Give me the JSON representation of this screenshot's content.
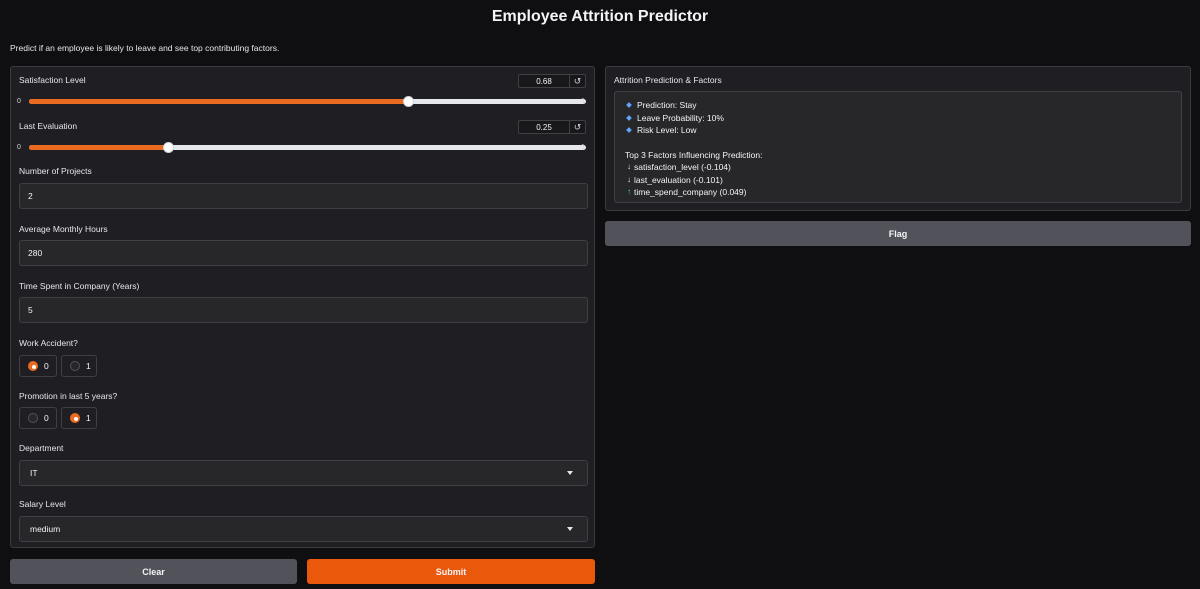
{
  "header": {
    "title": "Employee Attrition Predictor",
    "subtitle": "Predict if an employee is likely to leave and see top contributing factors."
  },
  "form": {
    "satisfaction": {
      "label": "Satisfaction Level",
      "value": "0.68",
      "min": "0",
      "max": "1",
      "fraction": 0.68
    },
    "evaluation": {
      "label": "Last Evaluation",
      "value": "0.25",
      "min": "0",
      "max": "1",
      "fraction": 0.25
    },
    "projects": {
      "label": "Number of Projects",
      "value": "2"
    },
    "hours": {
      "label": "Average Monthly Hours",
      "value": "280"
    },
    "tenure": {
      "label": "Time Spent in Company (Years)",
      "value": "5"
    },
    "accident": {
      "label": "Work Accident?",
      "options": [
        "0",
        "1"
      ],
      "selected": "0"
    },
    "promotion": {
      "label": "Promotion in last 5 years?",
      "options": [
        "0",
        "1"
      ],
      "selected": "1"
    },
    "department": {
      "label": "Department",
      "value": "IT"
    },
    "salary": {
      "label": "Salary Level",
      "value": "medium"
    }
  },
  "buttons": {
    "clear": "Clear",
    "submit": "Submit",
    "flag": "Flag"
  },
  "output": {
    "label": "Attrition Prediction & Factors",
    "bullets": [
      "Prediction: Stay",
      "Leave Probability: 10%",
      "Risk Level: Low"
    ],
    "factors_heading": "Top 3 Factors Influencing Prediction:",
    "factors": [
      {
        "direction": "down",
        "text": "satisfaction_level (-0.104)"
      },
      {
        "direction": "down",
        "text": "last_evaluation (-0.101)"
      },
      {
        "direction": "up",
        "text": "time_spend_company (0.049)"
      }
    ]
  },
  "colors": {
    "accent": "#ea580c",
    "bullet": "#60a5fa",
    "up_arrow": "#4ade80"
  }
}
